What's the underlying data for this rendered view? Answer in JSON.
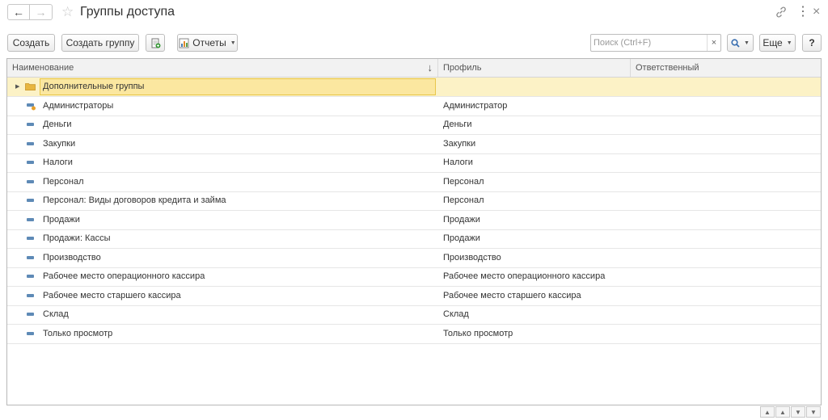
{
  "window": {
    "title": "Группы доступа"
  },
  "toolbar": {
    "create_label": "Создать",
    "create_group_label": "Создать группу",
    "reports_label": "Отчеты",
    "search_placeholder": "Поиск (Ctrl+F)",
    "search_clear": "×",
    "more_label": "Еще",
    "help_label": "?"
  },
  "table": {
    "columns": [
      "Наименование",
      "Профиль",
      "Ответственный"
    ],
    "sort_indicator": "↓",
    "rows": [
      {
        "name": "Дополнительные группы",
        "profile": "",
        "responsible": "",
        "type": "folder",
        "selected": true
      },
      {
        "name": "Администраторы",
        "profile": "Администратор",
        "responsible": "",
        "type": "admin"
      },
      {
        "name": "Деньги",
        "profile": "Деньги",
        "responsible": "",
        "type": "item"
      },
      {
        "name": "Закупки",
        "profile": "Закупки",
        "responsible": "",
        "type": "item"
      },
      {
        "name": "Налоги",
        "profile": "Налоги",
        "responsible": "",
        "type": "item"
      },
      {
        "name": "Персонал",
        "profile": "Персонал",
        "responsible": "",
        "type": "item"
      },
      {
        "name": "Персонал: Виды договоров кредита и займа",
        "profile": "Персонал",
        "responsible": "",
        "type": "item"
      },
      {
        "name": "Продажи",
        "profile": "Продажи",
        "responsible": "",
        "type": "item"
      },
      {
        "name": "Продажи: Кассы",
        "profile": "Продажи",
        "responsible": "",
        "type": "item"
      },
      {
        "name": "Производство",
        "profile": "Производство",
        "responsible": "",
        "type": "item"
      },
      {
        "name": "Рабочее место операционного кассира",
        "profile": "Рабочее место операционного кассира",
        "responsible": "",
        "type": "item"
      },
      {
        "name": "Рабочее место старшего кассира",
        "profile": "Рабочее место старшего кассира",
        "responsible": "",
        "type": "item"
      },
      {
        "name": "Склад",
        "profile": "Склад",
        "responsible": "",
        "type": "item"
      },
      {
        "name": "Только просмотр",
        "profile": "Только просмотр",
        "responsible": "",
        "type": "item"
      }
    ]
  },
  "colors": {
    "selected_row": "#fcf2c6",
    "selected_cell_border": "#e8c64a",
    "item_icon": "#5e8ab6",
    "folder_icon": "#e8b640"
  },
  "icons": {
    "back": "arrow-left-icon",
    "forward": "arrow-right-icon",
    "favorite": "star-icon",
    "link": "link-icon",
    "menu": "more-vertical-icon",
    "close": "close-icon",
    "export": "export-icon",
    "reports": "report-icon",
    "search": "search-icon"
  }
}
